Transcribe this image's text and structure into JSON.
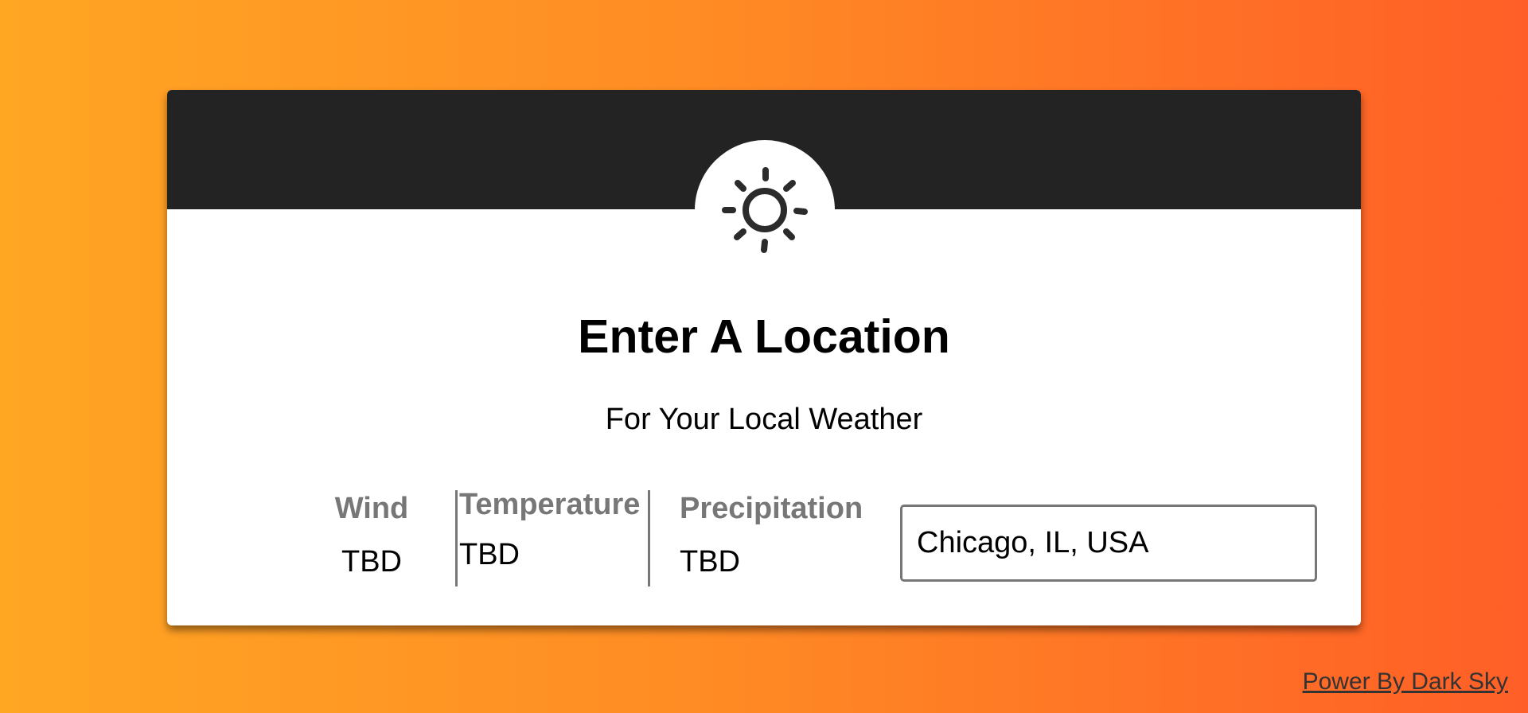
{
  "header": {
    "icon": "sun-icon",
    "background": "#232323"
  },
  "main": {
    "title": "Enter A Location",
    "subtitle": "For Your Local Weather"
  },
  "stats": {
    "wind": {
      "label": "Wind",
      "value": "TBD"
    },
    "temperature": {
      "label": "Temperature",
      "value": "TBD"
    },
    "precipitation": {
      "label": "Precipitation",
      "value": "TBD"
    }
  },
  "search": {
    "value": "Chicago, IL, USA"
  },
  "footer": {
    "link_text": "Power By Dark Sky"
  },
  "colors": {
    "gradient_start": "#ffa623",
    "gradient_end": "#ff5f27",
    "label_gray": "#777777"
  }
}
